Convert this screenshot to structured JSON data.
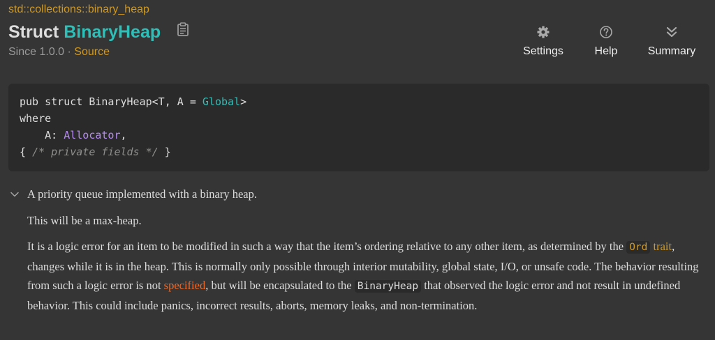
{
  "breadcrumb": {
    "part1": "std",
    "sep1": "::",
    "part2": "collections",
    "sep2": "::",
    "part3": "binary_heap"
  },
  "header": {
    "kind": "Struct",
    "name": "BinaryHeap",
    "since": "Since 1.0.0 · ",
    "source": "Source"
  },
  "toolbar": {
    "settings_label": "Settings",
    "help_label": "Help",
    "summary_label": "Summary"
  },
  "code": {
    "line1_prefix": "pub struct BinaryHeap<T, A = ",
    "line1_global": "Global",
    "line1_suffix": ">",
    "line2": "where",
    "line3_prefix": "    A: ",
    "line3_alloc": "Allocator",
    "line3_suffix": ",",
    "line4_open": "{ ",
    "line4_comment": "/* private fields */",
    "line4_close": " }"
  },
  "doc": {
    "summary": "A priority queue implemented with a binary heap.",
    "para1": "This will be a max-heap.",
    "para2": {
      "t1": "It is a logic error for an item to be modified in such a way that the item’s ordering relative to any other item, as determined by the ",
      "ord": "Ord",
      "trait": "trait",
      "t2": ", changes while it is in the heap. This is normally only possible through interior mutability, global state, I/O, or unsafe code. The behavior resulting from such a logic error is not ",
      "specified": "specified",
      "t3": ", but will be encapsulated to the ",
      "binaryheap": "BinaryHeap",
      "t4": " that observed the logic error and not result in undefined behavior. This could include panics, incorrect results, aborts, memory leaks, and non-termination."
    }
  },
  "colors": {
    "background": "#353535",
    "code_background": "#2a2a2a",
    "type_teal": "#2dbfb8",
    "link_gold": "#d2991d",
    "link_orange": "#ee6a2a",
    "trait_purple": "#b78cf2"
  },
  "icons": {
    "copy": "copy-path-icon",
    "settings": "gear-icon",
    "help": "question-circle-icon",
    "summary": "double-chevron-down-icon",
    "toggle": "chevron-down-icon"
  }
}
